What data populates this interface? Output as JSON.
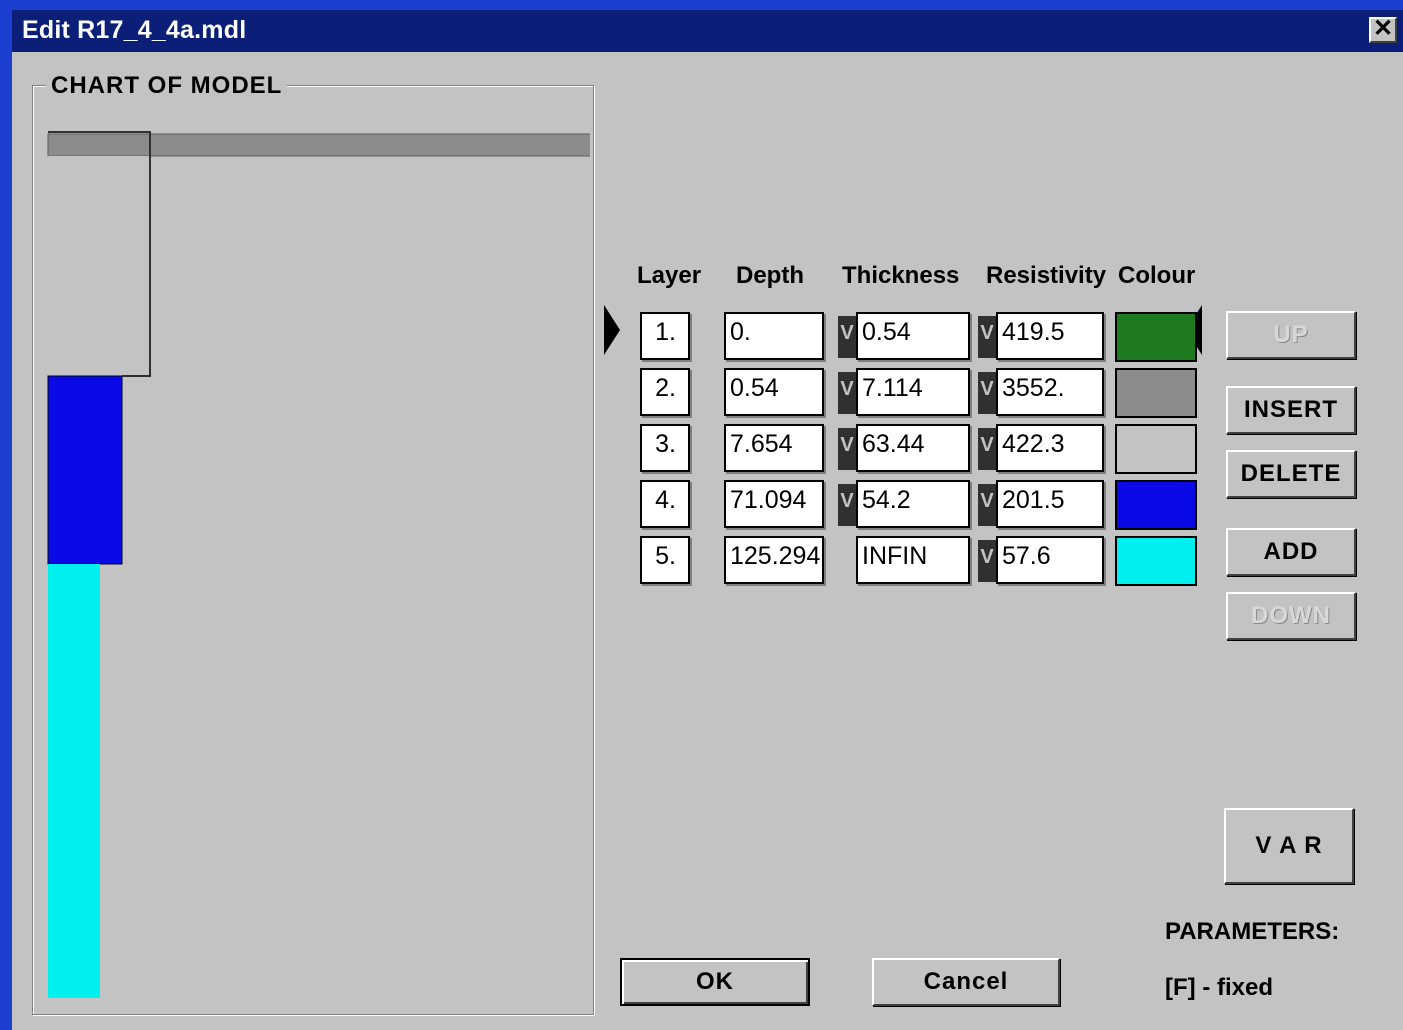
{
  "window": {
    "title": "Edit R17_4_4a.mdl",
    "close_label": "✕"
  },
  "chart": {
    "group_label": "CHART OF MODEL"
  },
  "table": {
    "headers": {
      "layer": "Layer",
      "depth": "Depth",
      "thickness": "Thickness",
      "resistivity": "Resistivity",
      "colour": "Colour"
    },
    "flag_label": "V",
    "rows": [
      {
        "layer": "1.",
        "depth": "0.",
        "thickness": "0.54",
        "resistivity": "419.5",
        "colour": "#1e7a1e",
        "thickness_flag": true
      },
      {
        "layer": "2.",
        "depth": "0.54",
        "thickness": "7.114",
        "resistivity": "3552.",
        "colour": "#8c8c8c",
        "thickness_flag": true
      },
      {
        "layer": "3.",
        "depth": "7.654",
        "thickness": "63.44",
        "resistivity": "422.3",
        "colour": "#c3c3c3",
        "thickness_flag": true
      },
      {
        "layer": "4.",
        "depth": "71.094",
        "thickness": "54.2",
        "resistivity": "201.5",
        "colour": "#0a0ae6",
        "thickness_flag": true
      },
      {
        "layer": "5.",
        "depth": "125.294",
        "thickness": "INFIN",
        "resistivity": "57.6",
        "colour": "#00f0f0",
        "thickness_flag": false
      }
    ]
  },
  "buttons": {
    "up": "UP",
    "insert": "INSERT",
    "delete": "DELETE",
    "add": "ADD",
    "down": "DOWN",
    "var": "V A R",
    "ok": "OK",
    "cancel": "Cancel"
  },
  "parameters": {
    "label": "PARAMETERS:",
    "fixed": "[F] - fixed"
  }
}
